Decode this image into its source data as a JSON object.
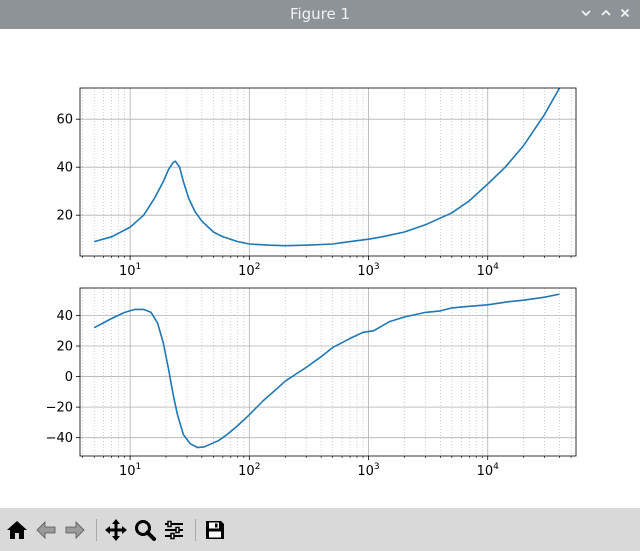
{
  "window": {
    "title": "Figure 1"
  },
  "toolbar": {
    "buttons": [
      {
        "icon": "home-icon"
      },
      {
        "icon": "back-icon"
      },
      {
        "icon": "forward-icon"
      },
      {
        "icon": "pan-icon"
      },
      {
        "icon": "zoom-icon"
      },
      {
        "icon": "configure-subplots-icon"
      },
      {
        "icon": "save-icon"
      }
    ]
  },
  "chart_data": [
    {
      "type": "line",
      "xscale": "log",
      "xlim": [
        3.8,
        55000
      ],
      "ylim": [
        3,
        73
      ],
      "grid": true,
      "minor_grid": true,
      "color": "#1f77b4",
      "yticks": [
        20,
        40,
        60
      ],
      "yticklabels": [
        "20",
        "40",
        "60"
      ],
      "xticks": [
        10,
        100,
        1000,
        10000
      ],
      "xticklabels": [
        [
          "10",
          "1"
        ],
        [
          "10",
          "2"
        ],
        [
          "10",
          "3"
        ],
        [
          "10",
          "4"
        ]
      ],
      "x": [
        5,
        7,
        10,
        13,
        16,
        19,
        21,
        23,
        24,
        26,
        28,
        31,
        35,
        40,
        50,
        60,
        80,
        100,
        150,
        200,
        300,
        500,
        700,
        1000,
        1300,
        2000,
        3000,
        5000,
        7000,
        10000,
        14000,
        20000,
        30000,
        40000
      ],
      "y": [
        9,
        11,
        15,
        20,
        27,
        34,
        39,
        42,
        42.5,
        40,
        34,
        27,
        21.5,
        17.5,
        13,
        11,
        9,
        8,
        7.5,
        7.3,
        7.5,
        8,
        9,
        10,
        11,
        13,
        16,
        21,
        26,
        33,
        40,
        49,
        62,
        73
      ]
    },
    {
      "type": "line",
      "xscale": "log",
      "xlim": [
        3.8,
        55000
      ],
      "ylim": [
        -52,
        58
      ],
      "grid": true,
      "minor_grid": true,
      "color": "#1f77b4",
      "yticks": [
        -40,
        -20,
        0,
        20,
        40
      ],
      "yticklabels": [
        "−40",
        "−20",
        "0",
        "20",
        "40"
      ],
      "xticks": [
        10,
        100,
        1000,
        10000
      ],
      "xticklabels": [
        [
          "10",
          "1"
        ],
        [
          "10",
          "2"
        ],
        [
          "10",
          "3"
        ],
        [
          "10",
          "4"
        ]
      ],
      "x": [
        5,
        7,
        9,
        11,
        13,
        15,
        17,
        19,
        21,
        23,
        25,
        28,
        32,
        37,
        42,
        48,
        55,
        65,
        80,
        100,
        130,
        170,
        200,
        250,
        300,
        400,
        500,
        700,
        900,
        1100,
        1500,
        2000,
        3000,
        4000,
        5000,
        7000,
        10000,
        15000,
        20000,
        30000,
        40000
      ],
      "y": [
        32,
        38,
        42,
        44,
        44,
        42,
        35,
        22,
        5,
        -12,
        -25,
        -38,
        -44,
        -46.5,
        -46,
        -44,
        -42,
        -38,
        -32,
        -25,
        -16,
        -8,
        -3,
        2,
        6,
        13,
        19,
        25,
        29,
        30,
        36,
        39,
        42,
        43,
        45,
        46,
        47,
        49,
        50,
        52,
        54
      ]
    }
  ]
}
